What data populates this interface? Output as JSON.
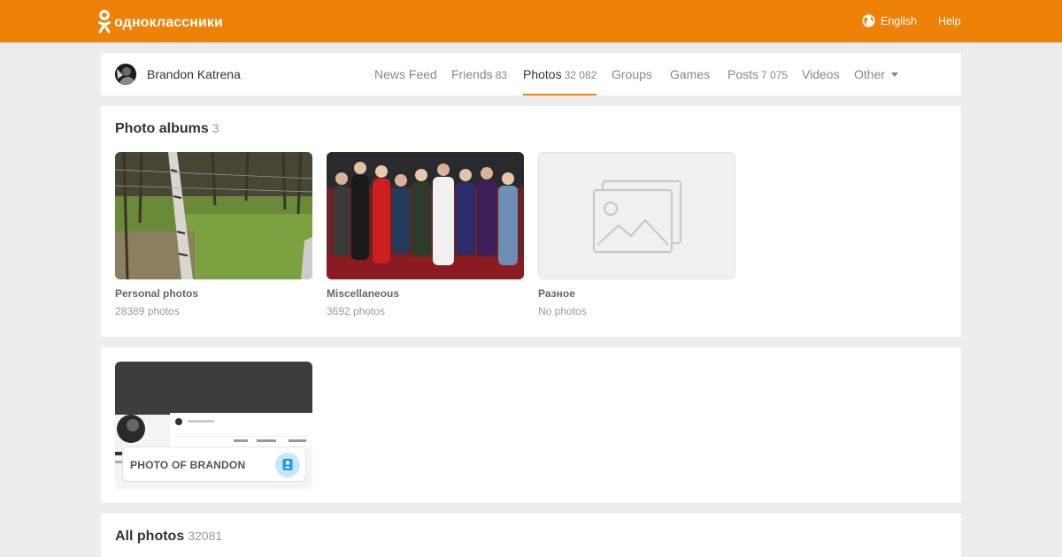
{
  "header": {
    "logo_text": "одноклассники",
    "language_label": "English",
    "help_label": "Help",
    "accent_color": "#ee8208"
  },
  "profile": {
    "name": "Brandon Katrena"
  },
  "nav": {
    "items": [
      {
        "label": "News Feed",
        "count": ""
      },
      {
        "label": "Friends",
        "count": "83"
      },
      {
        "label": "Photos",
        "count": "32 082",
        "active": true
      },
      {
        "label": "Groups",
        "count": ""
      },
      {
        "label": "Games",
        "count": ""
      },
      {
        "label": "Posts",
        "count": "7 075"
      },
      {
        "label": "Videos",
        "count": ""
      },
      {
        "label": "Other",
        "count": ""
      }
    ]
  },
  "albums": {
    "title": "Photo albums",
    "count": "3",
    "items": [
      {
        "name": "Personal photos",
        "count": "28389 photos",
        "thumb": "birch-trees-photo"
      },
      {
        "name": "Miscellaneous",
        "count": "3692 photos",
        "thumb": "group-photo"
      },
      {
        "name": "Разное",
        "count": "No photos",
        "thumb": "placeholder-icon"
      }
    ]
  },
  "tagged": {
    "label": "PHOTO OF BRANDON"
  },
  "all_photos": {
    "title": "All photos",
    "count": "32081"
  }
}
